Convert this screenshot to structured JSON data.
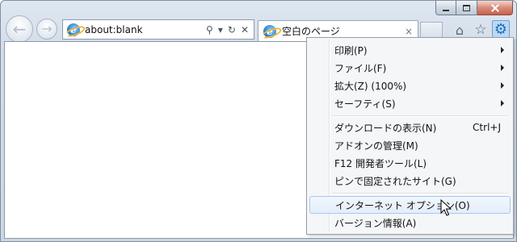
{
  "window": {
    "caption_buttons": [
      "minimize",
      "maximize",
      "close"
    ]
  },
  "address_bar": {
    "url": "about:blank",
    "icons": [
      "search-icon",
      "dropdown-icon",
      "refresh-icon",
      "stop-icon"
    ]
  },
  "tab": {
    "title": "空白のページ",
    "close_glyph": "×"
  },
  "toolbar": {
    "icons": [
      "home-icon",
      "favorites-star-icon",
      "tools-gear-icon"
    ]
  },
  "menu": {
    "items": [
      {
        "label": "印刷(P)",
        "has_submenu": true
      },
      {
        "label": "ファイル(F)",
        "has_submenu": true
      },
      {
        "label": "拡大(Z) (100%)",
        "has_submenu": true
      },
      {
        "label": "セーフティ(S)",
        "has_submenu": true
      },
      {
        "label": "ダウンロードの表示(N)",
        "accelerator": "Ctrl+J"
      },
      {
        "label": "アドオンの管理(M)"
      },
      {
        "label": "F12 開発者ツール(L)"
      },
      {
        "label": "ピンで固定されたサイト(G)"
      },
      {
        "label": "インターネット オプション(O)",
        "highlighted": true
      },
      {
        "label": "バージョン情報(A)"
      }
    ]
  },
  "colors": {
    "frame": "#d3dde9",
    "menu_bg": "#f5f6f8",
    "highlight_border": "#a8c8ee",
    "close_button": "#c9604a"
  }
}
